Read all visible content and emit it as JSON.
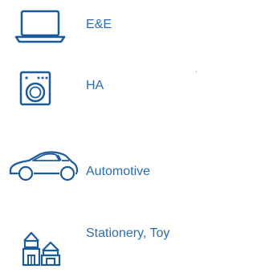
{
  "accent_color": "#2b6cb3",
  "items": [
    {
      "icon": "laptop-icon",
      "label": "E&E"
    },
    {
      "icon": "washing-machine-icon",
      "label": "HA"
    },
    {
      "icon": "car-icon",
      "label": "Automotive"
    },
    {
      "icon": "toy-blocks-icon",
      "label": "Stationery, Toy"
    }
  ]
}
